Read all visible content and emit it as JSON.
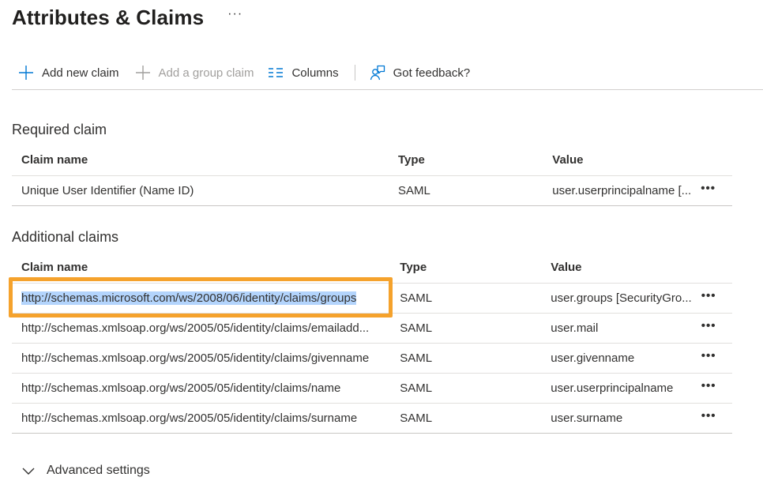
{
  "page": {
    "title": "Attributes & Claims",
    "more_label": "···"
  },
  "toolbar": {
    "add_new_claim": "Add new claim",
    "add_group_claim": "Add a group claim",
    "columns": "Columns",
    "got_feedback": "Got feedback?"
  },
  "required": {
    "section_title": "Required claim",
    "columns": {
      "name": "Claim name",
      "type": "Type",
      "value": "Value"
    },
    "rows": [
      {
        "name": "Unique User Identifier (Name ID)",
        "type": "SAML",
        "value": "user.userprincipalname [..."
      }
    ]
  },
  "additional": {
    "section_title": "Additional claims",
    "columns": {
      "name": "Claim name",
      "type": "Type",
      "value": "Value"
    },
    "rows": [
      {
        "name": "http://schemas.microsoft.com/ws/2008/06/identity/claims/groups",
        "type": "SAML",
        "value": "user.groups [SecurityGro..."
      },
      {
        "name": "http://schemas.xmlsoap.org/ws/2005/05/identity/claims/emailadd...",
        "type": "SAML",
        "value": "user.mail"
      },
      {
        "name": "http://schemas.xmlsoap.org/ws/2005/05/identity/claims/givenname",
        "type": "SAML",
        "value": "user.givenname"
      },
      {
        "name": "http://schemas.xmlsoap.org/ws/2005/05/identity/claims/name",
        "type": "SAML",
        "value": "user.userprincipalname"
      },
      {
        "name": "http://schemas.xmlsoap.org/ws/2005/05/identity/claims/surname",
        "type": "SAML",
        "value": "user.surname"
      }
    ]
  },
  "row_more_label": "•••",
  "advanced": {
    "label": "Advanced settings"
  },
  "colors": {
    "accent": "#0078d4",
    "highlight_border": "#f5a22c",
    "selection": "#b3d4fc"
  },
  "icons": {
    "add": "plus-icon",
    "add_group": "plus-icon",
    "columns": "columns-icon",
    "feedback": "feedback-icon",
    "advanced": "chevron-down-icon"
  }
}
